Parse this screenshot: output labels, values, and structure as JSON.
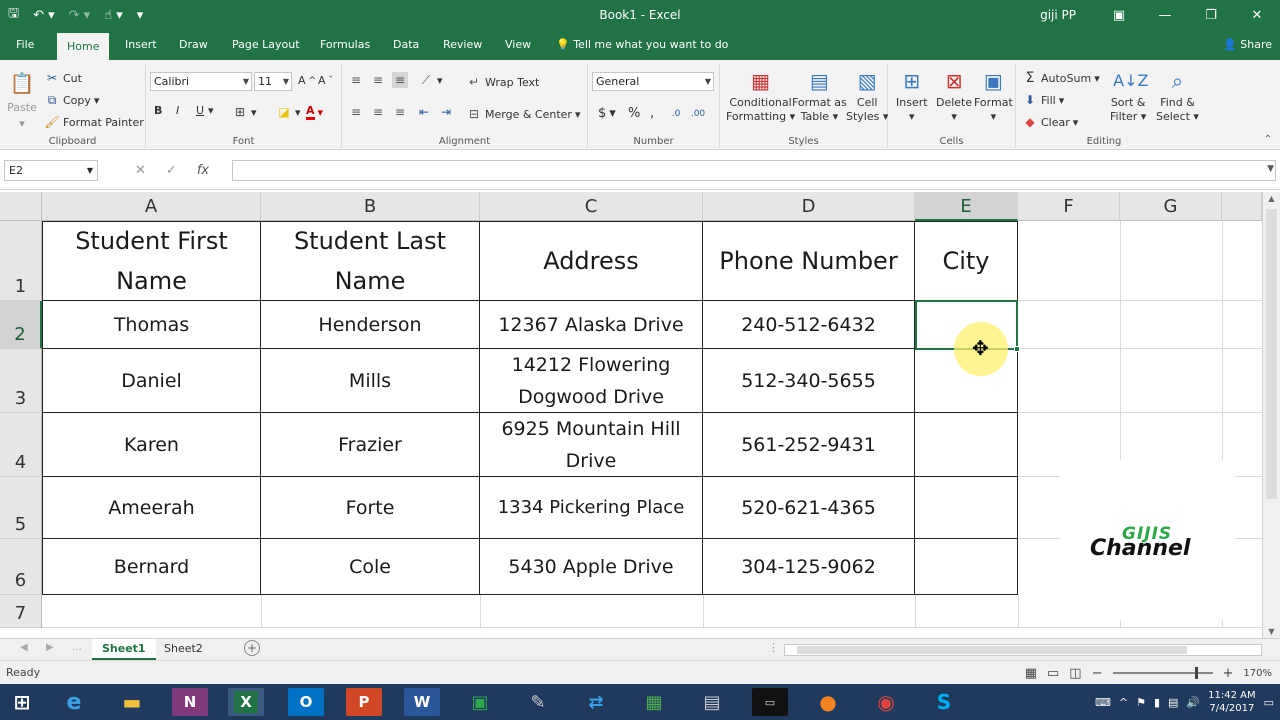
{
  "window": {
    "title": "Book1  -  Excel",
    "user": "giji PP"
  },
  "ribbon_tabs": [
    "File",
    "Home",
    "Insert",
    "Draw",
    "Page Layout",
    "Formulas",
    "Data",
    "Review",
    "View"
  ],
  "tell_me": "Tell me what you want to do",
  "share": "Share",
  "ribbon": {
    "clipboard": {
      "paste": "Paste",
      "cut": "Cut",
      "copy": "Copy",
      "format_painter": "Format Painter",
      "name": "Clipboard"
    },
    "font": {
      "family": "Calibri",
      "size": "11",
      "bold": "B",
      "italic": "I",
      "underline": "U",
      "name": "Font"
    },
    "alignment": {
      "wrap": "Wrap Text",
      "merge": "Merge & Center",
      "name": "Alignment"
    },
    "number": {
      "format": "General",
      "currency": "$",
      "percent": "%",
      "comma": ",",
      "name": "Number"
    },
    "styles": {
      "conditional": "Conditional",
      "conditional2": "Formatting",
      "format_as": "Format as",
      "format_as2": "Table",
      "cell": "Cell",
      "cell2": "Styles",
      "name": "Styles"
    },
    "cells": {
      "insert": "Insert",
      "delete": "Delete",
      "format": "Format",
      "name": "Cells"
    },
    "editing": {
      "autosum": "AutoSum",
      "fill": "Fill",
      "clear": "Clear",
      "sort": "Sort &",
      "sort2": "Filter",
      "find": "Find &",
      "find2": "Select",
      "name": "Editing"
    }
  },
  "formula_bar": {
    "name_box": "E2",
    "cancel": "✕",
    "enter": "✓",
    "fx": "fx",
    "content": ""
  },
  "columns": [
    "A",
    "B",
    "C",
    "D",
    "E",
    "F",
    "G"
  ],
  "selected_column": "E",
  "rows": [
    "1",
    "2",
    "3",
    "4",
    "5",
    "6",
    "7"
  ],
  "selected_row": "2",
  "headers": {
    "a1": "Student First Name",
    "b1": "Student Last Name",
    "c1": "Address",
    "d1": "Phone Number",
    "e1": "City"
  },
  "records": [
    {
      "first": "Thomas",
      "last": "Henderson",
      "address": "12367 Alaska Drive",
      "phone": "240-512-6432"
    },
    {
      "first": "Daniel",
      "last": "Mills",
      "address": "14212 Flowering Dogwood Drive",
      "phone": "512-340-5655"
    },
    {
      "first": "Karen",
      "last": "Frazier",
      "address": "6925 Mountain Hill Drive",
      "phone": "561-252-9431"
    },
    {
      "first": "Ameerah",
      "last": "Forte",
      "address": "1334 Pickering Place",
      "phone": "520-621-4365"
    },
    {
      "first": "Bernard",
      "last": "Cole",
      "address": "5430 Apple Drive",
      "phone": "304-125-9062"
    }
  ],
  "sheets": [
    "Sheet1",
    "Sheet2"
  ],
  "active_sheet": "Sheet1",
  "status": {
    "ready": "Ready",
    "zoom": "170%"
  },
  "logo": {
    "top": "GIJIS",
    "bottom": "Channel"
  },
  "clock": {
    "time": "11:42 AM",
    "date": "7/4/2017"
  },
  "colors": {
    "excel_green": "#217346",
    "taskbar": "#1f3a5c"
  }
}
